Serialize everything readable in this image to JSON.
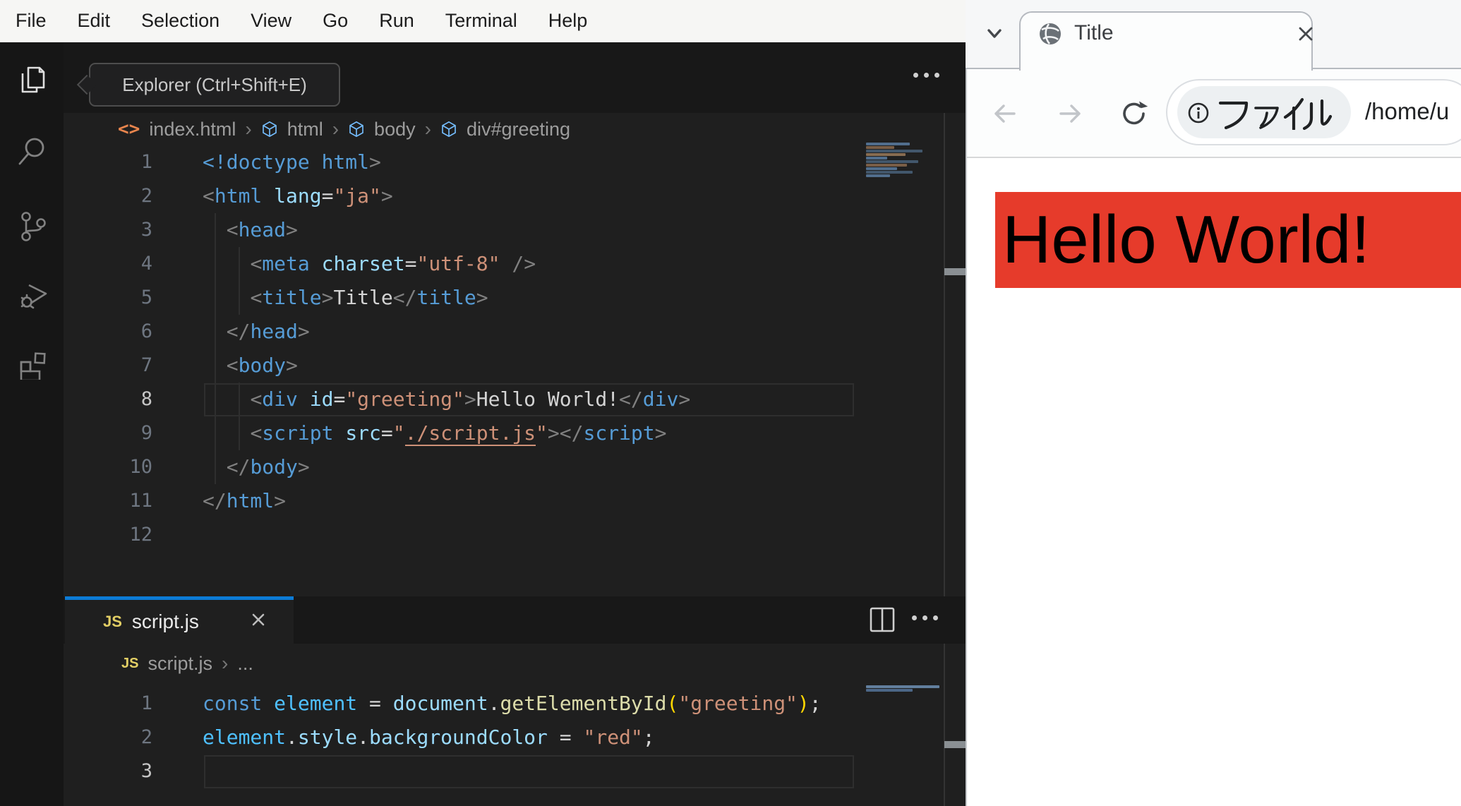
{
  "vscode": {
    "menu_bar": {
      "items": [
        "File",
        "Edit",
        "Selection",
        "View",
        "Go",
        "Run",
        "Terminal",
        "Help"
      ]
    },
    "activity_bar": {
      "tooltip": "Explorer (Ctrl+Shift+E)",
      "items": [
        "Explorer",
        "Search",
        "Source Control",
        "Run and Debug",
        "Extensions"
      ]
    },
    "editor": {
      "breadcrumb": {
        "file": "index.html",
        "path": [
          "html",
          "body",
          "div#greeting"
        ]
      },
      "active_line": 8,
      "lines": [
        [
          [
            "t",
            "<!doctype html"
          ],
          [
            "p",
            ">"
          ]
        ],
        [
          [
            "p",
            "<"
          ],
          [
            "t",
            "html"
          ],
          [
            "x",
            " "
          ],
          [
            "a",
            "lang"
          ],
          [
            "o",
            "="
          ],
          [
            "s",
            "\"ja\""
          ],
          [
            "p",
            ">"
          ]
        ],
        [
          [
            "x",
            "  "
          ],
          [
            "p",
            "<"
          ],
          [
            "t",
            "head"
          ],
          [
            "p",
            ">"
          ]
        ],
        [
          [
            "x",
            "    "
          ],
          [
            "p",
            "<"
          ],
          [
            "t",
            "meta"
          ],
          [
            "x",
            " "
          ],
          [
            "a",
            "charset"
          ],
          [
            "o",
            "="
          ],
          [
            "s",
            "\"utf-8\""
          ],
          [
            "x",
            " "
          ],
          [
            "p",
            "/>"
          ]
        ],
        [
          [
            "x",
            "    "
          ],
          [
            "p",
            "<"
          ],
          [
            "t",
            "title"
          ],
          [
            "p",
            ">"
          ],
          [
            "x",
            "Title"
          ],
          [
            "p",
            "</"
          ],
          [
            "t",
            "title"
          ],
          [
            "p",
            ">"
          ]
        ],
        [
          [
            "x",
            "  "
          ],
          [
            "p",
            "</"
          ],
          [
            "t",
            "head"
          ],
          [
            "p",
            ">"
          ]
        ],
        [
          [
            "x",
            "  "
          ],
          [
            "p",
            "<"
          ],
          [
            "t",
            "body"
          ],
          [
            "p",
            ">"
          ]
        ],
        [
          [
            "x",
            "    "
          ],
          [
            "p",
            "<"
          ],
          [
            "t",
            "div"
          ],
          [
            "x",
            " "
          ],
          [
            "a",
            "id"
          ],
          [
            "o",
            "="
          ],
          [
            "s",
            "\"greeting\""
          ],
          [
            "p",
            ">"
          ],
          [
            "x",
            "Hello World!"
          ],
          [
            "p",
            "</"
          ],
          [
            "t",
            "div"
          ],
          [
            "p",
            ">"
          ]
        ],
        [
          [
            "x",
            "    "
          ],
          [
            "p",
            "<"
          ],
          [
            "t",
            "script"
          ],
          [
            "x",
            " "
          ],
          [
            "a",
            "src"
          ],
          [
            "o",
            "="
          ],
          [
            "s",
            "\""
          ],
          [
            "u",
            "./script.js"
          ],
          [
            "s",
            "\""
          ],
          [
            "p",
            ">"
          ],
          [
            "p",
            "</"
          ],
          [
            "t",
            "script"
          ],
          [
            "p",
            ">"
          ]
        ],
        [
          [
            "x",
            "  "
          ],
          [
            "p",
            "</"
          ],
          [
            "t",
            "body"
          ],
          [
            "p",
            ">"
          ]
        ],
        [
          [
            "p",
            "</"
          ],
          [
            "t",
            "html"
          ],
          [
            "p",
            ">"
          ]
        ],
        []
      ]
    },
    "panel": {
      "tab": {
        "icon": "JS",
        "label": "script.js"
      },
      "breadcrumb": {
        "icon": "JS",
        "file": "script.js",
        "more": "..."
      },
      "active_line": 3,
      "lines": [
        [
          [
            "k",
            "const"
          ],
          [
            "o",
            " "
          ],
          [
            "v",
            "element"
          ],
          [
            "o",
            " = "
          ],
          [
            "pr",
            "document"
          ],
          [
            "o",
            "."
          ],
          [
            "f",
            "getElementById"
          ],
          [
            "b",
            "("
          ],
          [
            "s",
            "\"greeting\""
          ],
          [
            "b",
            ")"
          ],
          [
            "o",
            ";"
          ]
        ],
        [
          [
            "v",
            "element"
          ],
          [
            "o",
            "."
          ],
          [
            "pr",
            "style"
          ],
          [
            "o",
            "."
          ],
          [
            "pr",
            "backgroundColor"
          ],
          [
            "o",
            " = "
          ],
          [
            "s",
            "\"red\""
          ],
          [
            "o",
            ";"
          ]
        ],
        []
      ]
    },
    "colors": {
      "accent": "#0c7bd6",
      "editor_bg": "#1f1f1f",
      "chrome_bg": "#181818",
      "menu_bg": "#f6f6f4"
    }
  },
  "browser": {
    "tab": {
      "title": "Title"
    },
    "toolbar": {
      "address_chip": "ファイル",
      "url": "/home/u"
    },
    "page": {
      "heading": "Hello World!",
      "heading_bg": "#e63b2b"
    }
  }
}
